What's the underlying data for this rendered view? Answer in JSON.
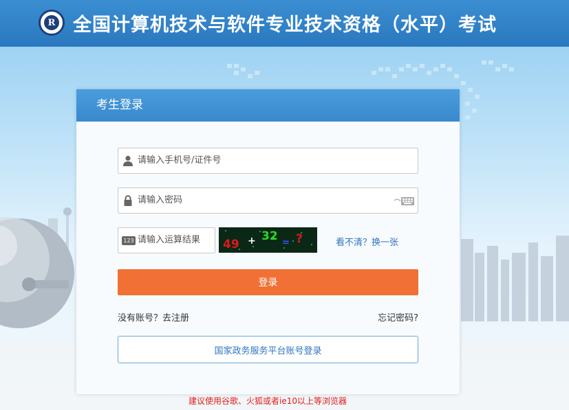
{
  "header": {
    "logo_letter": "R",
    "title": "全国计算机技术与软件专业技术资格（水平）考试"
  },
  "login": {
    "panel_title": "考生登录",
    "username_placeholder": "请输入手机号/证件号",
    "password_placeholder": "请输入密码",
    "captcha_placeholder": "请输入运算结果",
    "captcha_badge": "123",
    "captcha": {
      "a": "49",
      "op": "+",
      "b": "32",
      "eq": "=",
      "q": "?"
    },
    "refresh_label": "看不清？换一张",
    "submit_label": "登录",
    "register_label": "没有账号？去注册",
    "forgot_label": "忘记密码?",
    "gov_login_label": "国家政务服务平台账号登录"
  },
  "browser_tip": "建议使用谷歌、火狐或者ie10以上等浏览器",
  "colors": {
    "header": "#3b8ed1",
    "login_button": "#f07035",
    "link": "#2f74c2",
    "tip": "#e31a1a"
  }
}
